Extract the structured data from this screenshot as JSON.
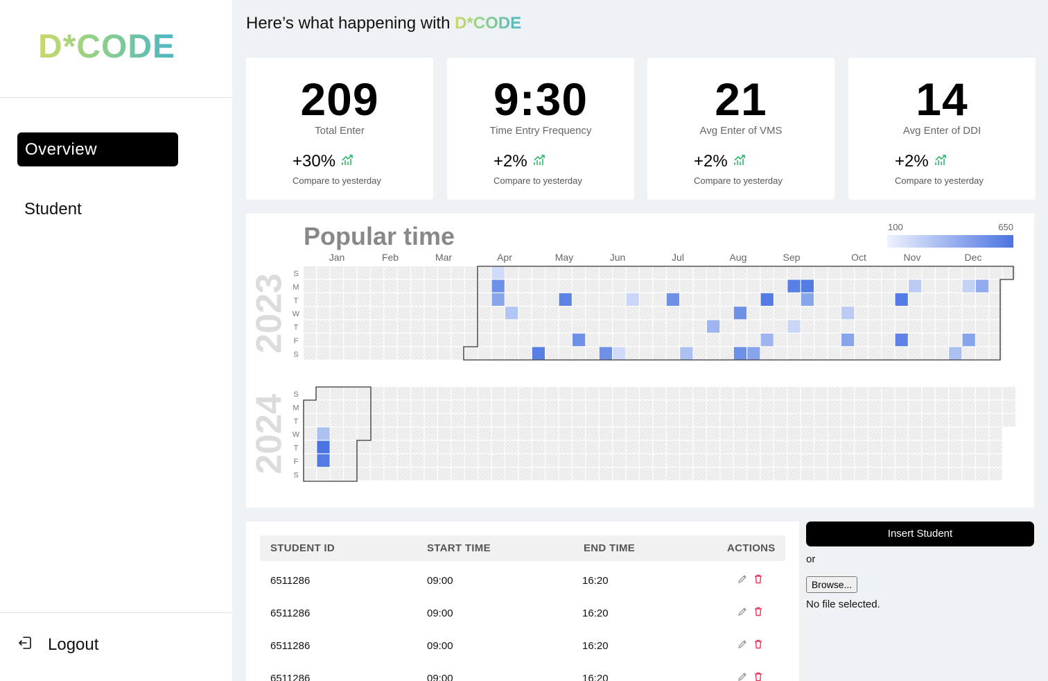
{
  "sidebar": {
    "logo": "D*CODE",
    "nav": {
      "overview": "Overview",
      "student": "Student"
    },
    "logout": "Logout"
  },
  "header": {
    "greeting": "Here’s what happening with",
    "brand": "D*CODE"
  },
  "stats": [
    {
      "value": "209",
      "label": "Total Enter",
      "change": "+30%",
      "compare": "Compare to yesterday"
    },
    {
      "value": "9:30",
      "label": "Time Entry Frequency",
      "change": "+2%",
      "compare": "Compare to yesterday"
    },
    {
      "value": "21",
      "label": "Avg Enter of VMS",
      "change": "+2%",
      "compare": "Compare to yesterday"
    },
    {
      "value": "14",
      "label": "Avg Enter of DDI",
      "change": "+2%",
      "compare": "Compare to yesterday"
    }
  ],
  "heatmap": {
    "title": "Popular time",
    "legend_min": "100",
    "legend_max": "650",
    "months": [
      "Jan",
      "Feb",
      "Mar",
      "Apr",
      "May",
      "Jun",
      "Jul",
      "Aug",
      "Sep",
      "Oct",
      "Nov",
      "Dec"
    ],
    "weekdays": [
      "S",
      "M",
      "T",
      "W",
      "T",
      "F",
      "S"
    ],
    "years": [
      "2023",
      "2024"
    ],
    "colors": {
      "low": "#eef2fd",
      "high": "#4a74e0",
      "empty": "#eeeeee"
    }
  },
  "chart_data": {
    "type": "heatmap",
    "title": "Popular time",
    "color_scale": [
      100,
      650
    ],
    "x_labels": [
      "Jan",
      "Feb",
      "Mar",
      "Apr",
      "May",
      "Jun",
      "Jul",
      "Aug",
      "Sep",
      "Oct",
      "Nov",
      "Dec"
    ],
    "y_labels": [
      "S",
      "M",
      "T",
      "W",
      "T",
      "F",
      "S"
    ],
    "cells_2023": [
      {
        "week": 14,
        "day": 0,
        "value": 180
      },
      {
        "week": 14,
        "day": 1,
        "value": 520
      },
      {
        "week": 14,
        "day": 2,
        "value": 430
      },
      {
        "week": 15,
        "day": 3,
        "value": 280
      },
      {
        "week": 17,
        "day": 6,
        "value": 600
      },
      {
        "week": 19,
        "day": 2,
        "value": 580
      },
      {
        "week": 20,
        "day": 5,
        "value": 520
      },
      {
        "week": 22,
        "day": 6,
        "value": 520
      },
      {
        "week": 23,
        "day": 6,
        "value": 180
      },
      {
        "week": 24,
        "day": 2,
        "value": 200
      },
      {
        "week": 27,
        "day": 2,
        "value": 520
      },
      {
        "week": 28,
        "day": 6,
        "value": 300
      },
      {
        "week": 30,
        "day": 4,
        "value": 350
      },
      {
        "week": 32,
        "day": 3,
        "value": 520
      },
      {
        "week": 32,
        "day": 6,
        "value": 520
      },
      {
        "week": 33,
        "day": 6,
        "value": 430
      },
      {
        "week": 34,
        "day": 2,
        "value": 620
      },
      {
        "week": 34,
        "day": 5,
        "value": 350
      },
      {
        "week": 36,
        "day": 1,
        "value": 600
      },
      {
        "week": 37,
        "day": 1,
        "value": 620
      },
      {
        "week": 37,
        "day": 2,
        "value": 430
      },
      {
        "week": 36,
        "day": 4,
        "value": 200
      },
      {
        "week": 40,
        "day": 3,
        "value": 250
      },
      {
        "week": 40,
        "day": 5,
        "value": 430
      },
      {
        "week": 44,
        "day": 2,
        "value": 620
      },
      {
        "week": 44,
        "day": 5,
        "value": 580
      },
      {
        "week": 45,
        "day": 1,
        "value": 250
      },
      {
        "week": 48,
        "day": 6,
        "value": 300
      },
      {
        "week": 49,
        "day": 1,
        "value": 220
      },
      {
        "week": 50,
        "day": 1,
        "value": 400
      },
      {
        "week": 49,
        "day": 5,
        "value": 430
      }
    ],
    "cells_2024": [
      {
        "week": 1,
        "day": 3,
        "value": 300
      },
      {
        "week": 1,
        "day": 4,
        "value": 650
      },
      {
        "week": 1,
        "day": 5,
        "value": 620
      }
    ]
  },
  "table": {
    "headers": {
      "id": "STUDENT ID",
      "start": "START TIME",
      "end": "END TIME",
      "actions": "ACTIONS"
    },
    "rows": [
      {
        "id": "6511286",
        "start": "09:00",
        "end": "16:20"
      },
      {
        "id": "6511286",
        "start": "09:00",
        "end": "16:20"
      },
      {
        "id": "6511286",
        "start": "09:00",
        "end": "16:20"
      },
      {
        "id": "6511286",
        "start": "09:00",
        "end": "16:20"
      }
    ]
  },
  "insert": {
    "button": "Insert Student",
    "or": "or",
    "browse": "Browse...",
    "no_file": "No file selected."
  }
}
